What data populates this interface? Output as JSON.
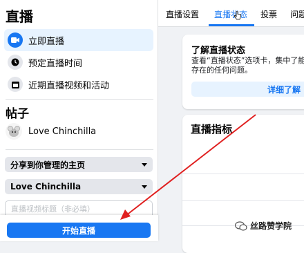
{
  "sidebar": {
    "title": "直播",
    "items": [
      {
        "label": "立即直播",
        "icon": "video-camera-icon"
      },
      {
        "label": "预定直播时间",
        "icon": "clock-icon"
      },
      {
        "label": "近期直播视频和活动",
        "icon": "calendar-icon"
      }
    ],
    "post_section": "帖子",
    "profile_name": "Love Chinchilla",
    "share_select": "分享到你管理的主页",
    "page_select": "Love Chinchilla",
    "title_placeholder": "直播视频标题（非必填）",
    "go_live_button": "开始直播"
  },
  "tabs": [
    {
      "label": "直播设置",
      "active": false
    },
    {
      "label": "直播状态",
      "active": true
    },
    {
      "label": "投票",
      "active": false
    },
    {
      "label": "问题",
      "active": false
    }
  ],
  "status_card": {
    "title": "了解直播状态",
    "description": "查看“直播状态”选项卡，集中了能存在的任何问题。",
    "button": "详细了解"
  },
  "metrics_card": {
    "title": "直播指标"
  },
  "watermark": {
    "text": "丝路赞学院"
  },
  "colors": {
    "accent": "#1877f2",
    "annotation_arrow": "#e02020"
  }
}
